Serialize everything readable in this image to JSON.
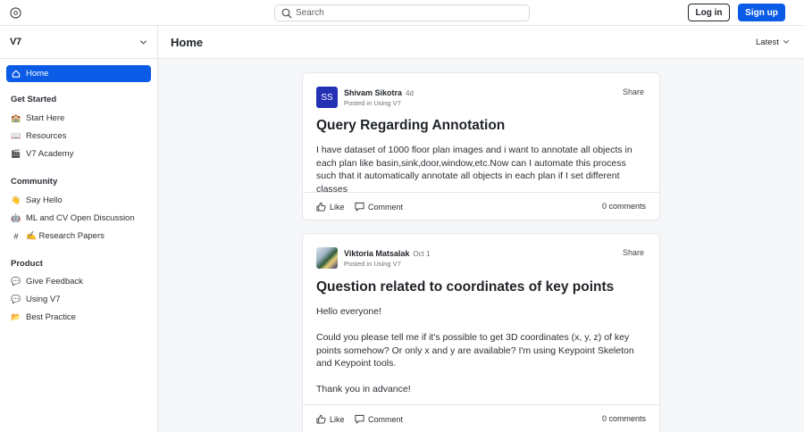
{
  "topbar": {
    "search_placeholder": "Search",
    "login_label": "Log in",
    "signup_label": "Sign up"
  },
  "sidebar": {
    "brand": "V7",
    "home_label": "Home",
    "sections": [
      {
        "title": "Get Started",
        "items": [
          {
            "icon": "🏫",
            "label": "Start Here"
          },
          {
            "icon": "📖",
            "label": "Resources"
          },
          {
            "icon": "🎬",
            "label": "V7 Academy"
          }
        ]
      },
      {
        "title": "Community",
        "items": [
          {
            "icon": "👋",
            "label": "Say Hello"
          },
          {
            "icon": "🤖",
            "label": "ML and CV Open Discussion"
          },
          {
            "icon": "#",
            "label": "✍️ Research Papers"
          }
        ]
      },
      {
        "title": "Product",
        "items": [
          {
            "icon": "💬",
            "label": "Give Feedback"
          },
          {
            "icon": "💬",
            "label": "Using V7"
          },
          {
            "icon": "📂",
            "label": "Best Practice"
          }
        ]
      }
    ]
  },
  "main": {
    "title": "Home",
    "sort_label": "Latest"
  },
  "posts": [
    {
      "avatar_initials": "SS",
      "author": "Shivam Sikotra",
      "time": "4d",
      "posted_in": "Posted in Using V7",
      "share_label": "Share",
      "title": "Query Regarding Annotation",
      "body": [
        "I have dataset of 1000 floor plan images and i want to annotate all objects in each plan like basin,sink,door,window,etc.Now can I automate this process such that it automatically annotate all objects in each plan if I set different classes"
      ],
      "like_label": "Like",
      "comment_label": "Comment",
      "comments_count": "0 comments"
    },
    {
      "avatar_initials": "",
      "author": "Viktoria Matsalak",
      "time": "Oct 1",
      "posted_in": "Posted in Using V7",
      "share_label": "Share",
      "title": "Question related to coordinates of key points",
      "body": [
        "Hello everyone!",
        "Could you please tell me if it's possible to get 3D coordinates (x, y, z) of key points somehow? Or only x and y are available? I'm using Keypoint Skeleton and Keypoint tools.",
        "Thank you in advance!"
      ],
      "like_label": "Like",
      "comment_label": "Comment",
      "comments_count": "0 comments"
    }
  ],
  "colors": {
    "accent": "#0a5ce6",
    "avatar_ss": "#2431b5"
  }
}
